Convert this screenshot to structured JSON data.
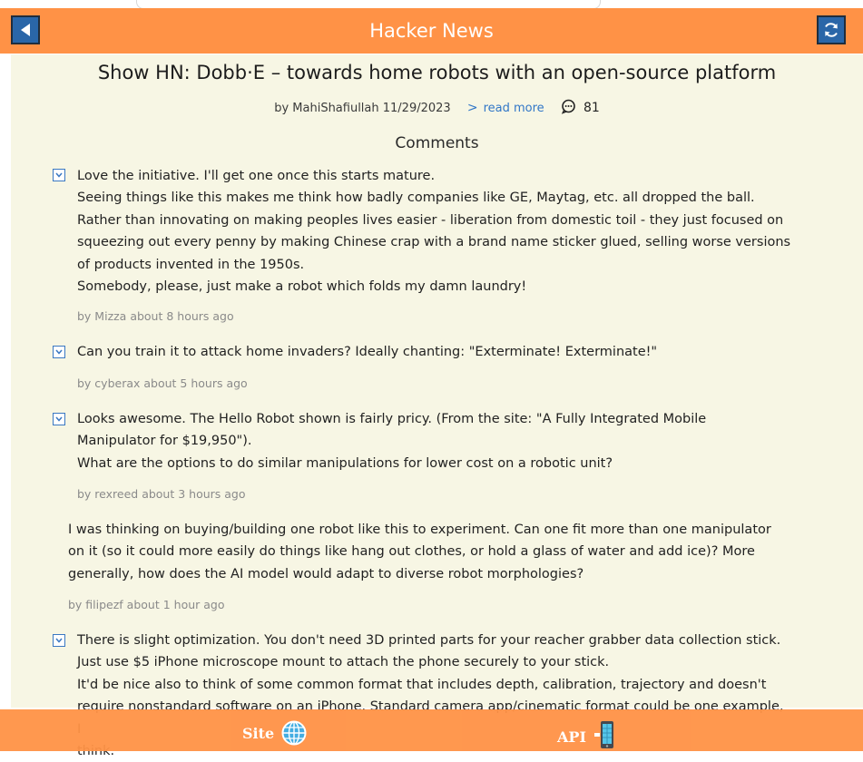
{
  "app": {
    "title": "Hacker News"
  },
  "post": {
    "title": "Show HN: Dobb·E – towards home robots with an open-source platform",
    "byline": "by MahiShafiullah 11/29/2023",
    "read_more": "read more",
    "comment_count": "81"
  },
  "comments_heading": "Comments",
  "comments": [
    {
      "lines": [
        "Love the initiative. I'll get one once this starts mature.",
        "Seeing things like this makes me think how badly companies like GE, Maytag, etc. all dropped the ball.",
        "Rather than innovating on making peoples lives easier - liberation from domestic toil - they just focused on",
        "squeezing out every penny by making Chinese crap with a brand name sticker glued, selling worse versions",
        "of products invented in the 1950s.",
        "Somebody, please, just make a robot which folds my damn laundry!"
      ],
      "by": "by Mizza about 8 hours ago"
    },
    {
      "lines": [
        "Can you train it to attack home invaders? Ideally chanting: \"Exterminate! Exterminate!\""
      ],
      "by": "by cyberax about 5 hours ago"
    },
    {
      "lines": [
        "Looks awesome. The Hello Robot shown is fairly pricy. (From the site: \"A Fully Integrated Mobile",
        "Manipulator for $19,950\").",
        "What are the options to do similar manipulations for lower cost on a robotic unit?"
      ],
      "by": "by rexreed about 3 hours ago"
    },
    {
      "lines": [
        "I was thinking on buying/building one robot like this to experiment. Can one fit more than one manipulator",
        "on it (so it could more easily do things like hang out clothes, or hold a glass of water and add ice)? More",
        "generally, how does the AI model would adapt to diverse robot morphologies?"
      ],
      "by": "by filipezf about 1 hour ago"
    },
    {
      "lines": [
        "There is slight optimization. You don't need 3D printed parts for your reacher grabber data collection stick.",
        "Just use $5 iPhone microscope mount to attach the phone securely to your stick.",
        "It'd be nice also to think of some common format that includes depth, calibration, trajectory and doesn't",
        "require nonstandard software on an iPhone. Standard camera app/cinematic format could be one example, I",
        "think."
      ]
    }
  ],
  "footer": {
    "site_label": "Site",
    "api_label": "API"
  },
  "colors": {
    "accent": "#ff9246",
    "button": "#2a66a8",
    "link": "#3277c7",
    "content_bg": "#f7f6e4"
  },
  "icons": [
    "back-arrow-icon",
    "refresh-icon",
    "chevron-right-icon",
    "comment-bubble-icon",
    "collapse-toggle-icon",
    "globe-icon",
    "mobile-phone-icon"
  ]
}
